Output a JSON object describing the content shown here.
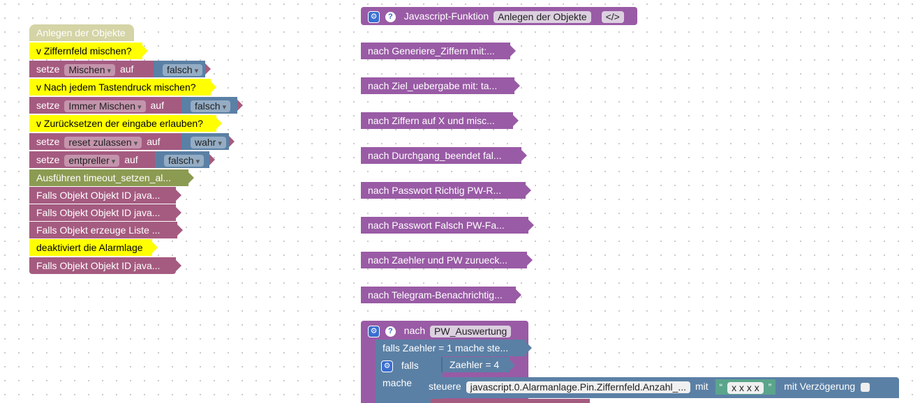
{
  "left_stack": {
    "hat": "Anlegen der Objekte",
    "rows": [
      {
        "type": "comment",
        "text": "v Ziffernfeld mischen?"
      },
      {
        "type": "set",
        "prefix": "setze",
        "var": "Mischen",
        "mid": "auf",
        "value": "falsch"
      },
      {
        "type": "comment",
        "text": "v Nach jedem Tastendruck mischen?"
      },
      {
        "type": "set",
        "prefix": "setze",
        "var": "Immer Mischen",
        "mid": "auf",
        "value": "falsch"
      },
      {
        "type": "comment",
        "text": "v Zurücksetzen der eingabe erlauben?"
      },
      {
        "type": "set",
        "prefix": "setze",
        "var": "reset zulassen",
        "mid": "auf",
        "value": "wahr"
      },
      {
        "type": "set",
        "prefix": "setze",
        "var": "entpreller",
        "mid": "auf",
        "value": "falsch"
      },
      {
        "type": "exec",
        "text": "Ausführen timeout_setzen_al..."
      },
      {
        "type": "falls",
        "text": "Falls Objekt Objekt ID java..."
      },
      {
        "type": "falls",
        "text": "Falls Objekt Objekt ID java..."
      },
      {
        "type": "falls",
        "text": "Falls Objekt erzeuge Liste ..."
      },
      {
        "type": "comment",
        "text": "deaktiviert die Alarmlage"
      },
      {
        "type": "falls",
        "text": "Falls Objekt Objekt ID java..."
      }
    ]
  },
  "js_function": {
    "label": "Javascript-Funktion",
    "name": "Anlegen der Objekte",
    "code_icon": "</>"
  },
  "right_blocks": [
    "nach Generiere_Ziffern mit:...",
    "nach Ziel_uebergabe mit: ta...",
    "nach Ziffern auf X und misc...",
    "nach Durchgang_beendet  fal...",
    "nach Passwort Richtig  PW-R...",
    "nach Passwort Falsch  PW-Fa...",
    "nach Zaehler und PW zurueck...",
    "nach Telegram-Benachrichtig..."
  ],
  "pw_function": {
    "label": "nach",
    "name": "PW_Auswertung",
    "falls_line": "falls Zaehler = 1 mache ste...",
    "falls_label": "falls",
    "condition": "Zaehler = 4",
    "mache_label": "mache",
    "steuere_label": "steuere",
    "object_id": "javascript.0.Alarmanlage.Pin.Ziffernfeld.Anzahl_...",
    "mit_label": "mit",
    "string_value": "x x x x",
    "delay_label": "mit Verzögerung"
  },
  "icons": {
    "gear": "gear-icon",
    "help": "help-icon"
  }
}
